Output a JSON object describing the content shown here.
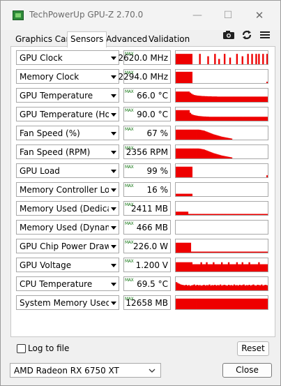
{
  "window": {
    "title": "TechPowerUp GPU-Z 2.70.0",
    "icon": "gpu-z-icon",
    "controls": {
      "minimize": "—",
      "maximize": "☐",
      "close": "✕"
    }
  },
  "tabs": [
    {
      "label": "Graphics Card",
      "active": false
    },
    {
      "label": "Sensors",
      "active": true
    },
    {
      "label": "Advanced",
      "active": false
    },
    {
      "label": "Validation",
      "active": false
    }
  ],
  "toolbar_icons": [
    "camera-icon",
    "refresh-icon",
    "menu-icon"
  ],
  "sensors": [
    {
      "label": "GPU Clock",
      "max_tag": "MAX",
      "value": "2620.0 MHz",
      "graph": [
        0.78,
        0.78,
        0.78,
        0.78,
        0.78,
        0.78,
        0.78,
        0.78,
        0.78,
        0.78,
        0.78,
        0.78,
        0,
        0,
        0,
        0,
        0,
        0.78,
        0,
        0,
        0,
        0,
        0,
        0.6,
        0,
        0,
        0,
        0,
        0.78,
        0,
        0,
        0.4,
        0,
        0,
        0,
        0.78,
        0,
        0,
        0,
        0.5,
        0,
        0,
        0,
        0,
        0.78,
        0,
        0,
        0,
        0.6,
        0,
        0,
        0,
        0.78,
        0,
        0,
        0.78,
        0,
        0,
        0.78,
        0,
        0.78,
        0,
        0,
        0.78,
        0,
        0,
        0.78
      ]
    },
    {
      "label": "Memory Clock",
      "max_tag": "MAX",
      "value": "2294.0 MHz",
      "graph": [
        0.85,
        0.85,
        0.85,
        0.85,
        0.85,
        0.85,
        0.85,
        0.85,
        0.85,
        0.85,
        0.85,
        0.85,
        0,
        0,
        0,
        0,
        0,
        0,
        0,
        0,
        0,
        0,
        0,
        0,
        0,
        0,
        0,
        0,
        0,
        0,
        0,
        0,
        0,
        0,
        0,
        0,
        0,
        0,
        0,
        0,
        0,
        0,
        0,
        0,
        0,
        0,
        0,
        0,
        0,
        0,
        0,
        0,
        0,
        0,
        0,
        0,
        0,
        0,
        0,
        0,
        0,
        0,
        0,
        0,
        0,
        0,
        0.1
      ]
    },
    {
      "label": "GPU Temperature",
      "max_tag": "MAX",
      "value": "66.0 °C",
      "graph": [
        0.78,
        0.78,
        0.78,
        0.78,
        0.78,
        0.78,
        0.78,
        0.78,
        0.78,
        0.78,
        0.7,
        0.62,
        0.56,
        0.52,
        0.5,
        0.48,
        0.47,
        0.46,
        0.45,
        0.44,
        0.44,
        0.43,
        0.43,
        0.42,
        0.42,
        0.42,
        0.41,
        0.41,
        0.41,
        0.41,
        0.4,
        0.4,
        0.4,
        0.4,
        0.4,
        0.4,
        0.4,
        0.4,
        0.4,
        0.4,
        0.4,
        0.4,
        0.4,
        0.4,
        0.4,
        0.4,
        0.4,
        0.4,
        0.4,
        0.4,
        0.4,
        0.4,
        0.4,
        0.4,
        0.4,
        0.4,
        0.4,
        0.4,
        0.4,
        0.4,
        0.4,
        0.4,
        0.4,
        0.4,
        0.4,
        0.4,
        0.4
      ]
    },
    {
      "label": "GPU Temperature (Hot Spot)",
      "max_tag": "MAX",
      "value": "90.0 °C",
      "graph": [
        0.8,
        0.8,
        0.8,
        0.8,
        0.8,
        0.8,
        0.8,
        0.8,
        0.8,
        0.8,
        0.6,
        0.5,
        0.45,
        0.42,
        0.4,
        0.38,
        0.36,
        0.35,
        0.34,
        0.33,
        0.32,
        0.32,
        0.31,
        0.31,
        0.3,
        0.3,
        0.3,
        0.3,
        0.3,
        0.3,
        0.3,
        0.3,
        0.3,
        0.3,
        0.3,
        0.3,
        0.3,
        0.3,
        0.3,
        0.3,
        0.3,
        0.3,
        0.3,
        0.3,
        0.3,
        0.3,
        0.3,
        0.3,
        0.3,
        0.3,
        0.3,
        0.3,
        0.3,
        0.3,
        0.3,
        0.3,
        0.3,
        0.3,
        0.3,
        0.3,
        0.3,
        0.3,
        0.3,
        0.3,
        0.3,
        0.3,
        0.3
      ]
    },
    {
      "label": "Fan Speed (%)",
      "max_tag": "MAX",
      "value": "67 %",
      "graph": [
        0.75,
        0.75,
        0.75,
        0.75,
        0.75,
        0.75,
        0.75,
        0.75,
        0.75,
        0.75,
        0.75,
        0.75,
        0.75,
        0.75,
        0.75,
        0.75,
        0.75,
        0.74,
        0.72,
        0.7,
        0.68,
        0.64,
        0.6,
        0.56,
        0.52,
        0.48,
        0.44,
        0.4,
        0.37,
        0.34,
        0.31,
        0.28,
        0.25,
        0.22,
        0.2,
        0.18,
        0.16,
        0.14,
        0.12,
        0.1,
        0.08,
        0,
        0,
        0,
        0,
        0,
        0,
        0,
        0,
        0,
        0,
        0,
        0,
        0,
        0,
        0,
        0,
        0,
        0,
        0,
        0,
        0,
        0,
        0,
        0,
        0,
        0
      ]
    },
    {
      "label": "Fan Speed (RPM)",
      "max_tag": "MAX",
      "value": "2356 RPM",
      "graph": [
        0.75,
        0.75,
        0.75,
        0.75,
        0.75,
        0.75,
        0.75,
        0.75,
        0.75,
        0.75,
        0.75,
        0.75,
        0.75,
        0.75,
        0.75,
        0.75,
        0.75,
        0.74,
        0.72,
        0.7,
        0.68,
        0.64,
        0.6,
        0.56,
        0.52,
        0.48,
        0.44,
        0.4,
        0.37,
        0.34,
        0.31,
        0.28,
        0.25,
        0.22,
        0.2,
        0.18,
        0.16,
        0.14,
        0.12,
        0.1,
        0.08,
        0,
        0,
        0,
        0,
        0,
        0,
        0,
        0,
        0,
        0,
        0,
        0,
        0,
        0,
        0,
        0,
        0,
        0,
        0,
        0,
        0,
        0,
        0,
        0,
        0,
        0
      ]
    },
    {
      "label": "GPU Load",
      "max_tag": "MAX",
      "value": "99 %",
      "graph": [
        0.8,
        0.8,
        0.8,
        0.8,
        0.8,
        0.8,
        0.8,
        0.8,
        0.8,
        0.8,
        0.8,
        0.8,
        0,
        0,
        0,
        0,
        0,
        0,
        0,
        0,
        0,
        0,
        0,
        0,
        0,
        0,
        0,
        0,
        0,
        0,
        0,
        0,
        0,
        0,
        0,
        0,
        0,
        0,
        0,
        0,
        0,
        0,
        0,
        0,
        0,
        0,
        0,
        0,
        0,
        0,
        0,
        0,
        0,
        0,
        0,
        0,
        0,
        0,
        0,
        0,
        0,
        0,
        0,
        0,
        0,
        0,
        0.15
      ]
    },
    {
      "label": "Memory Controller Load",
      "max_tag": "MAX",
      "value": "16 %",
      "graph": [
        0.18,
        0.18,
        0.18,
        0.18,
        0.18,
        0.18,
        0.18,
        0.18,
        0.18,
        0.18,
        0.18,
        0.18,
        0,
        0,
        0,
        0,
        0,
        0,
        0,
        0,
        0,
        0,
        0,
        0,
        0,
        0,
        0,
        0,
        0,
        0,
        0,
        0,
        0,
        0,
        0,
        0,
        0,
        0,
        0,
        0,
        0,
        0,
        0,
        0,
        0,
        0,
        0,
        0,
        0,
        0,
        0,
        0,
        0,
        0,
        0,
        0,
        0,
        0,
        0,
        0,
        0,
        0,
        0,
        0,
        0,
        0,
        0
      ]
    },
    {
      "label": "Memory Used (Dedicated)",
      "max_tag": "MAX",
      "value": "2411 MB",
      "graph": [
        0.25,
        0.25,
        0.25,
        0.25,
        0.25,
        0.25,
        0.25,
        0.25,
        0.25,
        0.08,
        0.08,
        0.08,
        0.08,
        0.08,
        0.08,
        0.08,
        0.08,
        0.08,
        0.08,
        0.08,
        0.08,
        0.08,
        0.08,
        0.08,
        0.08,
        0.08,
        0.08,
        0.08,
        0.08,
        0.08,
        0.08,
        0.08,
        0.08,
        0.08,
        0.08,
        0.08,
        0.08,
        0.08,
        0.08,
        0.08,
        0.08,
        0.08,
        0.08,
        0.08,
        0.08,
        0.08,
        0.08,
        0.08,
        0.08,
        0.08,
        0.08,
        0.08,
        0.08,
        0.08,
        0.08,
        0.08,
        0.08,
        0.08,
        0.08,
        0.08,
        0.08,
        0.08,
        0.08,
        0.08,
        0.08,
        0.08,
        0.08
      ]
    },
    {
      "label": "Memory Used (Dynamic)",
      "max_tag": "MAX",
      "value": "466 MB",
      "graph": [
        0,
        0,
        0,
        0,
        0,
        0,
        0,
        0,
        0,
        0,
        0,
        0,
        0,
        0,
        0,
        0,
        0,
        0,
        0,
        0,
        0,
        0,
        0,
        0,
        0,
        0,
        0,
        0,
        0,
        0,
        0,
        0,
        0,
        0,
        0,
        0,
        0,
        0,
        0,
        0,
        0,
        0,
        0,
        0,
        0,
        0,
        0,
        0,
        0,
        0,
        0,
        0,
        0,
        0,
        0,
        0,
        0,
        0,
        0,
        0,
        0,
        0,
        0,
        0,
        0,
        0,
        0
      ]
    },
    {
      "label": "GPU Chip Power Draw",
      "max_tag": "MAX",
      "value": "226.0 W",
      "graph": [
        0.75,
        0.75,
        0.75,
        0.75,
        0.75,
        0.75,
        0.75,
        0.75,
        0.75,
        0.75,
        0.75,
        0.08,
        0.08,
        0.08,
        0.08,
        0.08,
        0.08,
        0.08,
        0.08,
        0.08,
        0.08,
        0.08,
        0.08,
        0.08,
        0.08,
        0.08,
        0.08,
        0.08,
        0.08,
        0.08,
        0.08,
        0.08,
        0.08,
        0.08,
        0.08,
        0.08,
        0.08,
        0.08,
        0.08,
        0.08,
        0.08,
        0.08,
        0.08,
        0.08,
        0.08,
        0.08,
        0.08,
        0.08,
        0.08,
        0.08,
        0.08,
        0.08,
        0.08,
        0.08,
        0.08,
        0.08,
        0.08,
        0.08,
        0.08,
        0.08,
        0.08,
        0.08,
        0.08,
        0.08,
        0.08,
        0.08,
        0.08
      ]
    },
    {
      "label": "GPU Voltage",
      "max_tag": "MAX",
      "value": "1.200 V",
      "graph": [
        0.7,
        0.7,
        0.7,
        0.7,
        0.7,
        0.7,
        0.7,
        0.7,
        0.7,
        0.7,
        0.7,
        0.7,
        0.55,
        0.55,
        0.55,
        0.55,
        0.55,
        0.55,
        0.7,
        0.55,
        0.55,
        0.55,
        0.7,
        0.55,
        0.55,
        0.55,
        0.55,
        0.7,
        0.55,
        0.55,
        0.55,
        0.55,
        0.55,
        0.7,
        0.55,
        0.55,
        0.55,
        0.55,
        0.7,
        0.55,
        0.55,
        0.55,
        0.55,
        0.55,
        0.7,
        0.55,
        0.55,
        0.55,
        0.7,
        0.55,
        0.55,
        0.55,
        0.55,
        0.7,
        0.55,
        0.55,
        0.55,
        0.55,
        0.55,
        0.55,
        0.7,
        0.55,
        0.55,
        0.55,
        0.55,
        0.55,
        0.55
      ]
    },
    {
      "label": "CPU Temperature",
      "max_tag": "MAX",
      "value": "69.5 °C",
      "graph": [
        0.62,
        0.55,
        0.5,
        0.45,
        0.42,
        0.4,
        0.38,
        0.42,
        0.36,
        0.4,
        0.34,
        0.38,
        0.4,
        0.44,
        0.36,
        0.42,
        0.38,
        0.4,
        0.36,
        0.38,
        0.42,
        0.36,
        0.4,
        0.38,
        0.44,
        0.36,
        0.4,
        0.38,
        0.42,
        0.36,
        0.4,
        0.38,
        0.44,
        0.36,
        0.4,
        0.42,
        0.38,
        0.36,
        0.42,
        0.38,
        0.4,
        0.36,
        0.44,
        0.38,
        0.4,
        0.36,
        0.42,
        0.38,
        0.4,
        0.44,
        0.36,
        0.4,
        0.38,
        0.42,
        0.36,
        0.4,
        0.44,
        0.38,
        0.36,
        0.42,
        0.4,
        0.38,
        0.44,
        0.36,
        0.4,
        0.42,
        0.38
      ]
    },
    {
      "label": "System Memory Used",
      "max_tag": "MAX",
      "value": "12658 MB",
      "graph": [
        0.8,
        0.8,
        0.8,
        0.8,
        0.8,
        0.8,
        0.8,
        0.8,
        0.8,
        0.8,
        0.8,
        0.8,
        0.8,
        0.8,
        0.8,
        0.8,
        0.8,
        0.8,
        0.8,
        0.8,
        0.8,
        0.8,
        0.8,
        0.8,
        0.8,
        0.8,
        0.8,
        0.8,
        0.8,
        0.8,
        0.8,
        0.8,
        0.8,
        0.8,
        0.8,
        0.8,
        0.8,
        0.8,
        0.8,
        0.8,
        0.8,
        0.8,
        0.8,
        0.8,
        0.8,
        0.8,
        0.8,
        0.8,
        0.8,
        0.8,
        0.8,
        0.8,
        0.8,
        0.8,
        0.8,
        0.8,
        0.8,
        0.8,
        0.8,
        0.8,
        0.8,
        0.8,
        0.8,
        0.8,
        0.8,
        0.8,
        0.8
      ]
    }
  ],
  "graph_color": "#ee0000",
  "footer": {
    "log_to_file": "Log to file",
    "log_checked": false,
    "reset": "Reset",
    "gpu_selected": "AMD Radeon RX 6750 XT",
    "close": "Close"
  }
}
